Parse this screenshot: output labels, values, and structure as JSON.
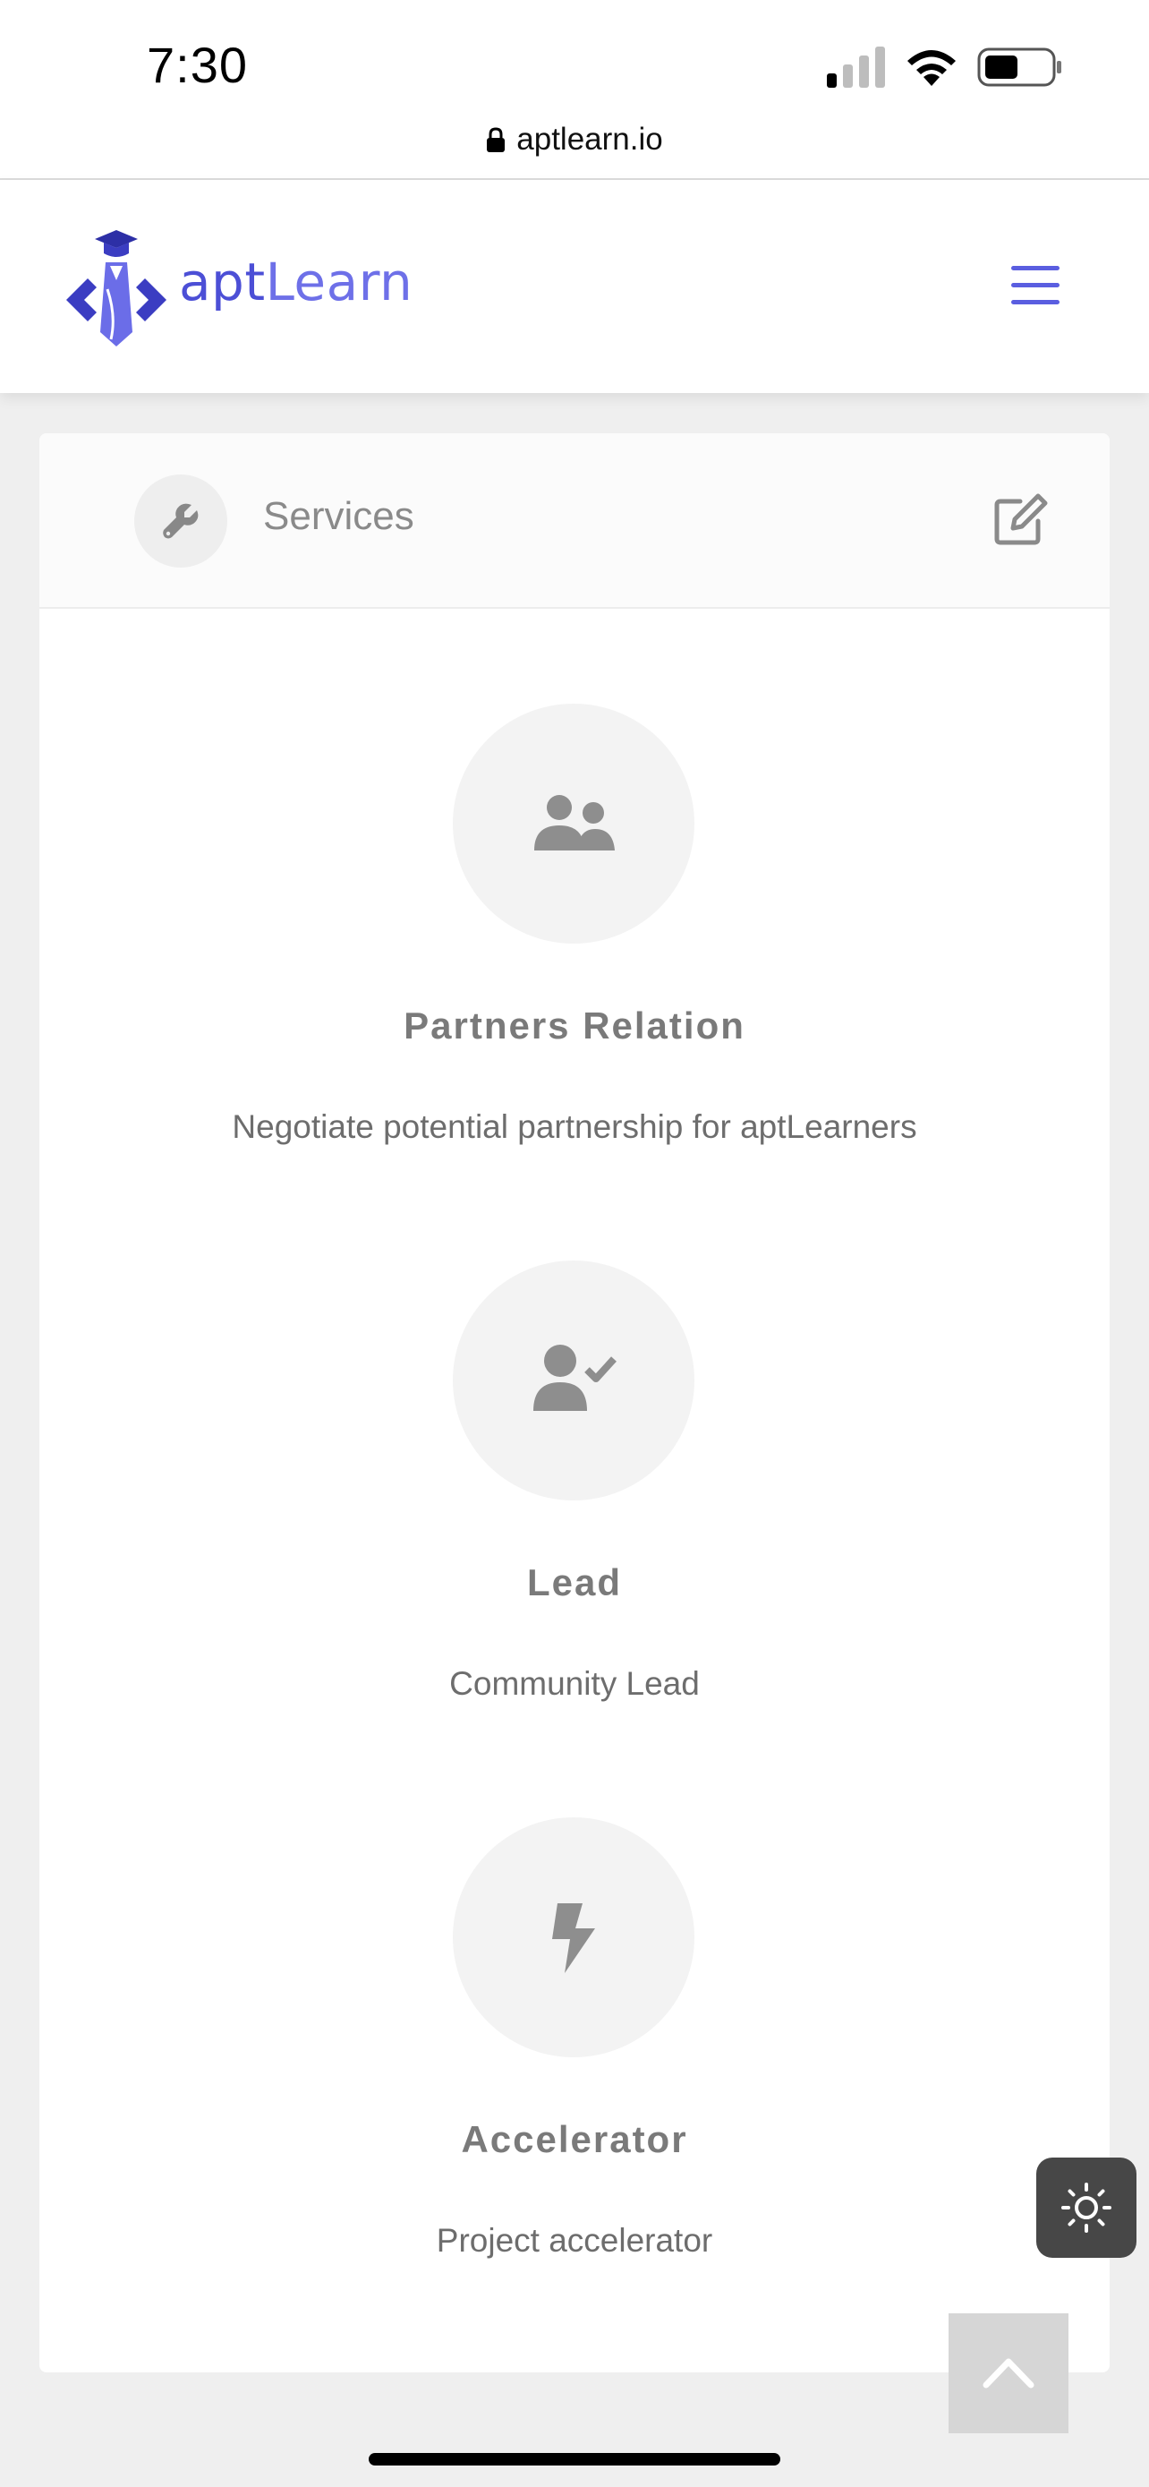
{
  "status_bar": {
    "time": "7:30",
    "url": "aptlearn.io",
    "icons": [
      "signal-icon",
      "wifi-icon",
      "battery-icon",
      "lock-icon"
    ]
  },
  "header": {
    "logo_text_primary": "apt",
    "logo_text_secondary": "Learn",
    "menu_icon": "hamburger-menu-icon",
    "brand_color": "#4c4fd6"
  },
  "card": {
    "title": "Services",
    "title_icon": "wrench-icon",
    "edit_icon": "edit-icon",
    "services": [
      {
        "icon": "users-icon",
        "title": "Partners Relation",
        "description": "Negotiate potential partnership for aptLearners"
      },
      {
        "icon": "user-check-icon",
        "title": "Lead",
        "description": "Community Lead"
      },
      {
        "icon": "bolt-icon",
        "title": "Accelerator",
        "description": "Project accelerator"
      }
    ]
  },
  "floating": {
    "theme_icon": "sun-icon",
    "scroll_top_icon": "chevron-up-icon"
  }
}
